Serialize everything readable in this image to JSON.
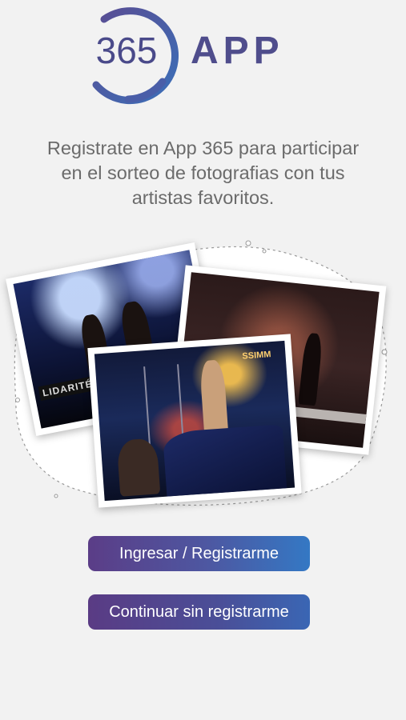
{
  "logo": {
    "digits": "365",
    "word": "APP",
    "icon": "circle-ring-logo-icon"
  },
  "intro": {
    "line1": "Registrate en App 365 para participar",
    "line2": "en el sorteo de fotografias con tus",
    "line3": "artistas favoritos."
  },
  "collage": {
    "photo1_banner": "LIDARITÉS",
    "photo3_sign": "SSIMM"
  },
  "buttons": {
    "primary_label": "Ingresar / Registrarme",
    "secondary_label": "Continuar sin registrarme"
  },
  "colors": {
    "background": "#f2f2f2",
    "brand_purple": "#4f4d8c",
    "brand_blue": "#3478c4",
    "text_gray": "#6b6b6b"
  }
}
